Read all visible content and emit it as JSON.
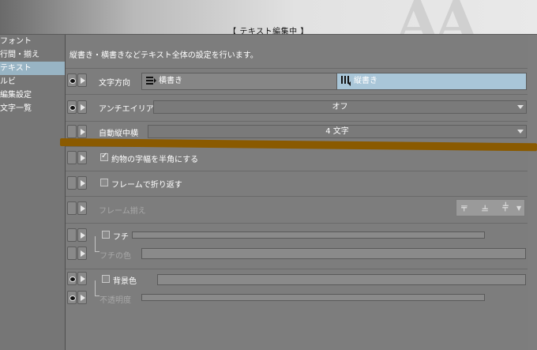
{
  "header": {
    "title": "【 テキスト編集中 】"
  },
  "sidebar": {
    "items": [
      {
        "label": "フォント",
        "active": false
      },
      {
        "label": "行間・揃え",
        "active": false
      },
      {
        "label": "テキスト",
        "active": true
      },
      {
        "label": "ルビ",
        "active": false
      },
      {
        "label": "編集設定",
        "active": false
      },
      {
        "label": "文字一覧",
        "active": false
      }
    ]
  },
  "main": {
    "description": "縦書き・横書きなどテキスト全体の設定を行います。",
    "direction": {
      "label": "文字方向",
      "options": [
        "横書き",
        "縦書き"
      ],
      "selected": "縦書き"
    },
    "antialias": {
      "label": "アンチエイリアス",
      "value": "オフ"
    },
    "tatechuyoko": {
      "label": "自動縦中横",
      "value": "4 文字"
    },
    "halfwidth": {
      "label": "約物の字幅を半角にする",
      "checked": true
    },
    "frame_wrap": {
      "label": "フレームで折り返す",
      "checked": false
    },
    "frame_align": {
      "label": "フレーム揃え"
    },
    "border": {
      "label": "フチ",
      "color_label": "フチの色",
      "checked": false
    },
    "background": {
      "label": "背景色",
      "opacity_label": "不透明度",
      "checked": false
    }
  },
  "colors": {
    "panel_bg": "#7d7d7d",
    "selected_bg": "#a9c6d8",
    "annotation": "#8a5a00"
  }
}
